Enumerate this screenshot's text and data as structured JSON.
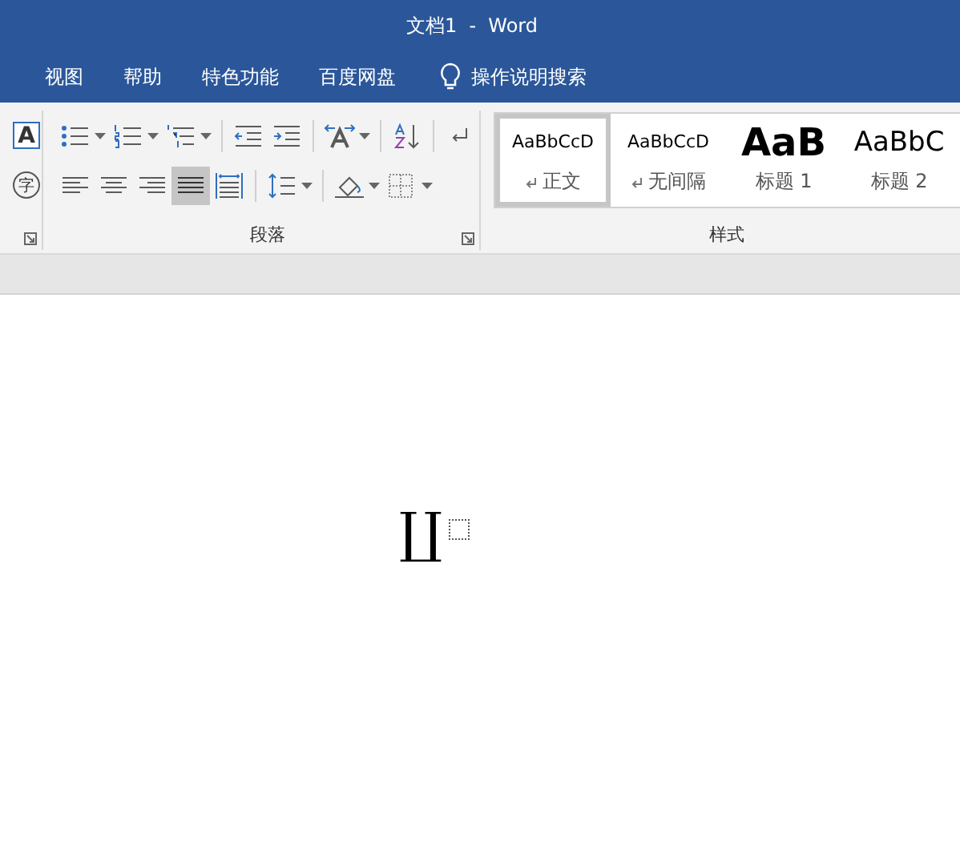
{
  "window": {
    "title": "文档1  -  Word"
  },
  "tabs": [
    {
      "label": "视图",
      "selected": false
    },
    {
      "label": "帮助",
      "selected": false
    },
    {
      "label": "特色功能",
      "selected": false
    },
    {
      "label": "百度网盘",
      "selected": false
    }
  ],
  "tell_me": {
    "label": "操作说明搜索"
  },
  "font_group": {
    "border_char": "A",
    "enclose_char": "字"
  },
  "paragraph_group": {
    "label": "段落",
    "row_1": [
      {
        "kind": "bullets",
        "dropdown": true
      },
      {
        "kind": "numbering",
        "dropdown": true
      },
      {
        "kind": "multilevel",
        "dropdown": true
      },
      {
        "kind": "separator"
      },
      {
        "kind": "outdent"
      },
      {
        "kind": "indent"
      },
      {
        "kind": "separator"
      },
      {
        "kind": "asian-layout",
        "dropdown": true
      },
      {
        "kind": "separator"
      },
      {
        "kind": "sort"
      },
      {
        "kind": "separator"
      },
      {
        "kind": "marks"
      }
    ],
    "row_2": [
      {
        "kind": "align-left",
        "selected": false
      },
      {
        "kind": "align-center",
        "selected": false
      },
      {
        "kind": "align-right",
        "selected": false
      },
      {
        "kind": "justify",
        "selected": true
      },
      {
        "kind": "distribute",
        "selected": false
      },
      {
        "kind": "separator"
      },
      {
        "kind": "line-spacing",
        "dropdown": true
      },
      {
        "kind": "separator"
      },
      {
        "kind": "shading",
        "dropdown": true
      },
      {
        "kind": "borders",
        "dropdown": true
      }
    ]
  },
  "styles_group": {
    "label": "样式",
    "styles": [
      {
        "preview": "AaBbCcD",
        "name": "正文",
        "kind": "normal",
        "para_mark": true,
        "selected": true
      },
      {
        "preview": "AaBbCcD",
        "name": "无间隔",
        "kind": "normal",
        "para_mark": true,
        "selected": false
      },
      {
        "preview": "AaB",
        "name": "标题 1",
        "kind": "heading1",
        "para_mark": false,
        "selected": false
      },
      {
        "preview": "AaBbC",
        "name": "标题 2",
        "kind": "heading2",
        "para_mark": false,
        "selected": false
      }
    ]
  },
  "document": {
    "equation_symbol": "∐"
  }
}
